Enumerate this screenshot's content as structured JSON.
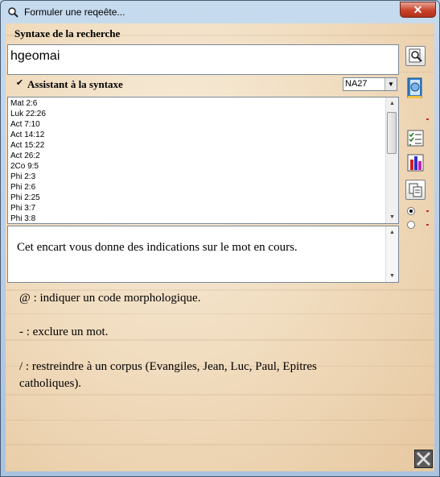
{
  "window": {
    "title": "Formuler une reqeête..."
  },
  "syntax": {
    "label": "Syntaxe de la recherche",
    "query": "hgeomai"
  },
  "assistant": {
    "label": "Assistant à la syntaxe",
    "checked": true,
    "text_version": "NA27"
  },
  "results": [
    "Mat 2:6",
    "Luk 22:26",
    "Act 7:10",
    "Act 14:12",
    "Act 15:22",
    "Act 26:2",
    "2Co 9:5",
    "Phi 2:3",
    "Phi 2:6",
    "Phi 2:25",
    "Phi 3:7",
    "Phi 3:8"
  ],
  "info": {
    "text": "Cet encart vous donne des indications sur le mot en cours."
  },
  "help": [
    "@ : indiquer un code morphologique.",
    "- : exclure un mot.",
    "/ : restreindre à un corpus (Evangiles, Jean, Luc, Paul, Epitres catholiques)."
  ],
  "toolbar": {
    "icons": [
      "search-icon",
      "book-search-icon",
      "checklist-icon",
      "bar-chart-icon",
      "copy-icon"
    ],
    "colors": {
      "bar1": "#d02020",
      "bar2": "#3030c0",
      "bar3": "#c020c0",
      "accent": "#c03030"
    }
  }
}
